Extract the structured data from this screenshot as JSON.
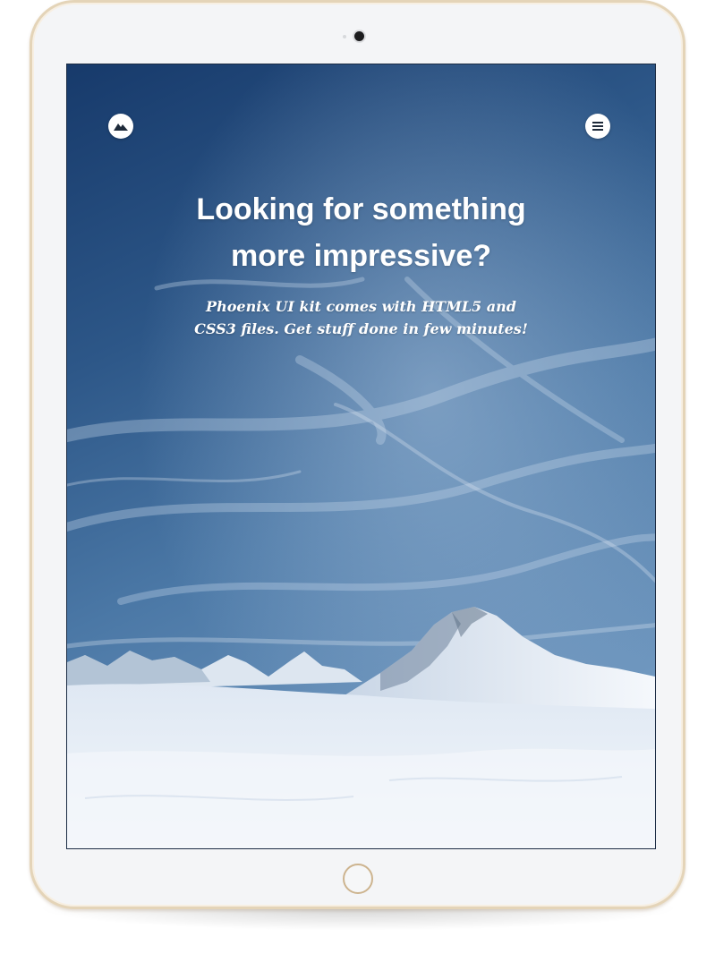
{
  "hero": {
    "headline_line1": "Looking for something",
    "headline_line2": "more impressive?",
    "subtitle_line1": "Phoenix UI kit comes with HTML5 and",
    "subtitle_line2": "CSS3 files. Get stuff done in few minutes!"
  },
  "icons": {
    "logo": "mountain-logo-icon",
    "menu": "hamburger-menu-icon"
  },
  "colors": {
    "sky_top": "#1d4275",
    "sky_mid": "#3f6a98",
    "snow": "#eef3f9",
    "device_frame": "#e4d4b8",
    "device_body": "#f4f5f7",
    "text": "#ffffff"
  }
}
